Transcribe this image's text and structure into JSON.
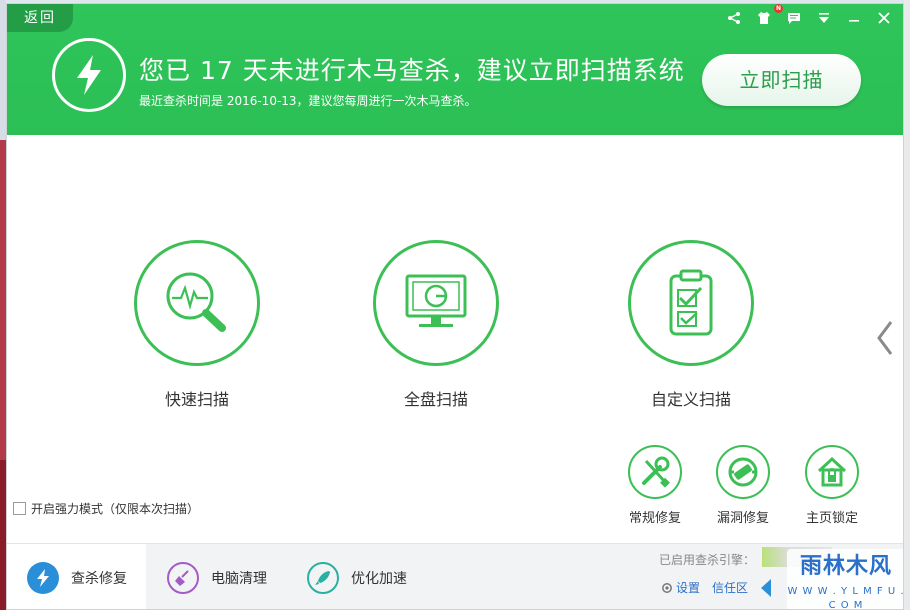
{
  "header": {
    "back_label": "返回",
    "title": "您已 17 天未进行木马查杀，建议立即扫描系统",
    "subtitle": "最近查杀时间是 2016-10-13，建议您每周进行一次木马查杀。",
    "scan_now_label": "立即扫描",
    "notification_badge": "N"
  },
  "scan_options": [
    {
      "label": "快速扫描",
      "icon": "magnifier-pulse-icon"
    },
    {
      "label": "全盘扫描",
      "icon": "monitor-chart-icon"
    },
    {
      "label": "自定义扫描",
      "icon": "clipboard-check-icon"
    }
  ],
  "tools": [
    {
      "label": "常规修复",
      "icon": "tools-icon"
    },
    {
      "label": "漏洞修复",
      "icon": "patch-icon"
    },
    {
      "label": "主页锁定",
      "icon": "home-lock-icon"
    }
  ],
  "strong_mode": {
    "label": "开启强力模式（仅限本次扫描）",
    "checked": false
  },
  "bottom_nav": [
    {
      "label": "查杀修复",
      "active": true,
      "icon": "lightning-icon",
      "color": "#2a8fd9"
    },
    {
      "label": "电脑清理",
      "active": false,
      "icon": "broom-icon",
      "color": "#a35cc7"
    },
    {
      "label": "优化加速",
      "active": false,
      "icon": "rocket-icon",
      "color": "#2ab0a0"
    }
  ],
  "engine": {
    "label": "已启用查杀引擎："
  },
  "links": {
    "settings": "设置",
    "trust": "信任区"
  },
  "watermark": {
    "title": "雨林木风",
    "url": "W W W . Y L M F U . C O M"
  },
  "colors": {
    "accent_green": "#2fc55a",
    "ring_green": "#3cbf55"
  }
}
